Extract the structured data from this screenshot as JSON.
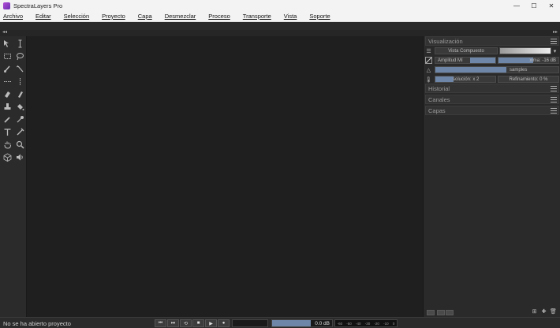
{
  "window": {
    "title": "SpectraLayers Pro",
    "controls": {
      "minimize": "—",
      "maximize": "☐",
      "close": "✕"
    }
  },
  "menu": [
    "Archivo",
    "Editar",
    "Selección",
    "Proyecto",
    "Capa",
    "Desmezclar",
    "Proceso",
    "Transporte",
    "Vista",
    "Soporte"
  ],
  "collapse": {
    "left": "◂◂",
    "right": "▸▸"
  },
  "right_panel": {
    "visualizacion": {
      "title": "Visualización",
      "view_button": "Vista Compuesto",
      "amp_min": "Amplitud Mí",
      "amp_max": "xima: -16 dB",
      "fft": "samples",
      "resolution": "solución: x 2",
      "refinement": "Refinamiento: 0 %"
    },
    "historial": "Historial",
    "canales": "Canales",
    "capas": "Capas"
  },
  "status": {
    "text": "No se ha abierto proyecto",
    "gain": "0.0 dB",
    "meter_ticks": [
      "-60",
      "-50",
      "-40",
      "-30",
      "-20",
      "-10",
      "0"
    ],
    "transport": [
      "⏮",
      "⏭",
      "⟲",
      "■",
      "▶",
      "●"
    ]
  }
}
